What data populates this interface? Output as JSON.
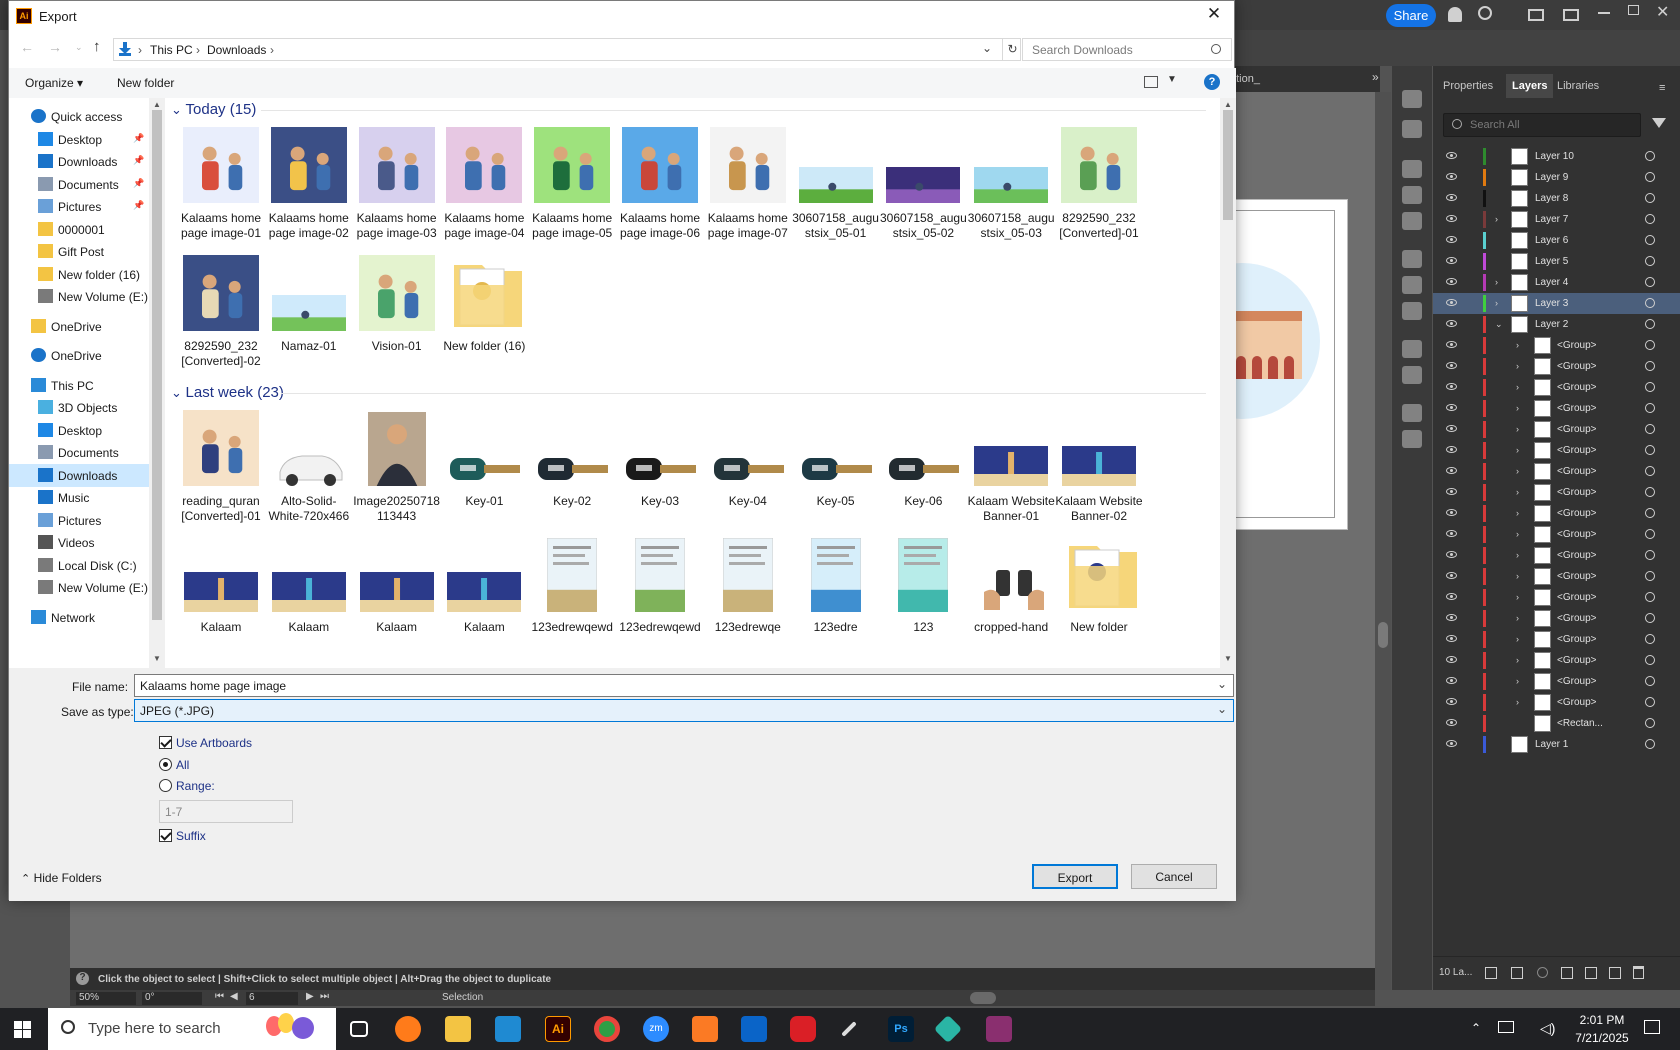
{
  "illustrator": {
    "top": {
      "share_label": "Share"
    },
    "document_tab": "ple_giving_donation_",
    "panel_tabs": [
      "Properties",
      "Layers",
      "Libraries"
    ],
    "search_placeholder": "Search All",
    "layers": [
      {
        "name": "Layer 10",
        "color": "#2e8b2e",
        "expand": false
      },
      {
        "name": "Layer 9",
        "color": "#e07a10",
        "expand": false
      },
      {
        "name": "Layer 8",
        "color": "#111111",
        "expand": false
      },
      {
        "name": "Layer 7",
        "color": "#7a3a3a",
        "expand": true
      },
      {
        "name": "Layer 6",
        "color": "#5ad0d0",
        "expand": false
      },
      {
        "name": "Layer 5",
        "color": "#c04ad8",
        "expand": false
      },
      {
        "name": "Layer 4",
        "color": "#b53ab5",
        "expand": true
      },
      {
        "name": "Layer 3",
        "color": "#3fcf3f",
        "expand": true,
        "selected": true
      },
      {
        "name": "Layer 2",
        "color": "#d83a3a",
        "expand": true,
        "open": true
      },
      {
        "name": "<Group>",
        "color": "#d83a3a",
        "sub": true
      },
      {
        "name": "<Group>",
        "color": "#d83a3a",
        "sub": true
      },
      {
        "name": "<Group>",
        "color": "#d83a3a",
        "sub": true
      },
      {
        "name": "<Group>",
        "color": "#d83a3a",
        "sub": true
      },
      {
        "name": "<Group>",
        "color": "#d83a3a",
        "sub": true
      },
      {
        "name": "<Group>",
        "color": "#d83a3a",
        "sub": true
      },
      {
        "name": "<Group>",
        "color": "#d83a3a",
        "sub": true
      },
      {
        "name": "<Group>",
        "color": "#d83a3a",
        "sub": true
      },
      {
        "name": "<Group>",
        "color": "#d83a3a",
        "sub": true
      },
      {
        "name": "<Group>",
        "color": "#d83a3a",
        "sub": true
      },
      {
        "name": "<Group>",
        "color": "#d83a3a",
        "sub": true
      },
      {
        "name": "<Group>",
        "color": "#d83a3a",
        "sub": true
      },
      {
        "name": "<Group>",
        "color": "#d83a3a",
        "sub": true
      },
      {
        "name": "<Group>",
        "color": "#d83a3a",
        "sub": true
      },
      {
        "name": "<Group>",
        "color": "#d83a3a",
        "sub": true
      },
      {
        "name": "<Group>",
        "color": "#d83a3a",
        "sub": true
      },
      {
        "name": "<Group>",
        "color": "#d83a3a",
        "sub": true
      },
      {
        "name": "<Group>",
        "color": "#d83a3a",
        "sub": true
      },
      {
        "name": "<Rectan...",
        "color": "#d83a3a",
        "sub": true,
        "noexpand": true
      },
      {
        "name": "Layer 1",
        "color": "#3a5ad8",
        "expand": false
      }
    ],
    "layers_count": "10 La...",
    "status_hint": "Click the object to select  |  Shift+Click to select multiple object  |  Alt+Drag the object to duplicate",
    "zoom": "50%",
    "rotation": "0°",
    "artboard_num": "6",
    "tool_name": "Selection"
  },
  "dialog": {
    "title": "Export",
    "breadcrumb": [
      "This PC",
      "Downloads"
    ],
    "search_placeholder": "Search Downloads",
    "organize_label": "Organize",
    "new_folder_label": "New folder",
    "nav": [
      {
        "label": "Quick access",
        "icon": "star-icon",
        "level": 0
      },
      {
        "label": "Desktop",
        "icon": "desktop-icon",
        "level": 1,
        "pin": true
      },
      {
        "label": "Downloads",
        "icon": "download-icon",
        "level": 1,
        "pin": true
      },
      {
        "label": "Documents",
        "icon": "documents-icon",
        "level": 1,
        "pin": true
      },
      {
        "label": "Pictures",
        "icon": "pictures-icon",
        "level": 1,
        "pin": true
      },
      {
        "label": "0000001",
        "icon": "folder-icon",
        "level": 1
      },
      {
        "label": "Gift Post",
        "icon": "folder-icon",
        "level": 1
      },
      {
        "label": "New folder (16)",
        "icon": "folder-icon",
        "level": 1
      },
      {
        "label": "New Volume (E:)",
        "icon": "drive-icon",
        "level": 1
      },
      {
        "label": "OneDrive",
        "icon": "folder-icon",
        "level": 0,
        "gap": true
      },
      {
        "label": "OneDrive",
        "icon": "cloud-icon",
        "level": 0,
        "gap": true
      },
      {
        "label": "This PC",
        "icon": "computer-icon",
        "level": 0,
        "gap": true
      },
      {
        "label": "3D Objects",
        "icon": "cube-icon",
        "level": 1
      },
      {
        "label": "Desktop",
        "icon": "desktop-icon",
        "level": 1
      },
      {
        "label": "Documents",
        "icon": "documents-icon",
        "level": 1
      },
      {
        "label": "Downloads",
        "icon": "download-icon",
        "level": 1,
        "selected": true
      },
      {
        "label": "Music",
        "icon": "music-icon",
        "level": 1
      },
      {
        "label": "Pictures",
        "icon": "pictures-icon",
        "level": 1
      },
      {
        "label": "Videos",
        "icon": "video-icon",
        "level": 1
      },
      {
        "label": "Local Disk (C:)",
        "icon": "drive-icon",
        "level": 1
      },
      {
        "label": "New Volume (E:)",
        "icon": "drive-icon",
        "level": 1
      },
      {
        "label": "Network",
        "icon": "network-icon",
        "level": 0,
        "gap": true
      }
    ],
    "groups": [
      {
        "label": "Today (15)",
        "rows": [
          [
            {
              "caption": "Kalaams home page image-01",
              "kind": "illus",
              "c1": "#e9eefc",
              "c2": "#d94f3d"
            },
            {
              "caption": "Kalaams home page image-02",
              "kind": "illus",
              "c1": "#3b4f86",
              "c2": "#f2c34a"
            },
            {
              "caption": "Kalaams home page image-03",
              "kind": "illus",
              "c1": "#d7d0ee",
              "c2": "#4a5a8a"
            },
            {
              "caption": "Kalaams home page image-04",
              "kind": "illus",
              "c1": "#e7c8e3",
              "c2": "#3e6fb0"
            },
            {
              "caption": "Kalaams home page image-05",
              "kind": "illus",
              "c1": "#9ee27d",
              "c2": "#1e6e3c"
            },
            {
              "caption": "Kalaams home page image-06",
              "kind": "illus",
              "c1": "#5aa9e8",
              "c2": "#c9473a"
            },
            {
              "caption": "Kalaams home page image-07",
              "kind": "illus",
              "c1": "#f3f3f3",
              "c2": "#c8964e"
            },
            {
              "caption": "30607158_augustsix_05-01",
              "kind": "wide",
              "c1": "#cde9f8",
              "c2": "#5cae3e"
            },
            {
              "caption": "30607158_augustsix_05-02",
              "kind": "wide",
              "c1": "#3b2f7a",
              "c2": "#8a5bb8"
            },
            {
              "caption": "30607158_augustsix_05-03",
              "kind": "wide",
              "c1": "#9fd8ef",
              "c2": "#6bbf5a"
            },
            {
              "caption": "8292590_232 [Converted]-01",
              "kind": "illus",
              "c1": "#d9f0c9",
              "c2": "#5a9f54"
            }
          ],
          [
            {
              "caption": "8292590_232 [Converted]-02",
              "kind": "illus",
              "c1": "#3a4f86",
              "c2": "#e7d9b5"
            },
            {
              "caption": "Namaz-01",
              "kind": "wide",
              "c1": "#cfeafb",
              "c2": "#74c25a"
            },
            {
              "caption": "Vision-01",
              "kind": "illus",
              "c1": "#e4f3cf",
              "c2": "#4aa36b"
            },
            {
              "caption": "New folder (16)",
              "kind": "folder",
              "c1": "#f6d67a",
              "c2": "#e3b84e"
            }
          ]
        ]
      },
      {
        "label": "Last week (23)",
        "rows": [
          [
            {
              "caption": "reading_quran [Converted]-01",
              "kind": "illus",
              "c1": "#f6e2c8",
              "c2": "#2f3f7e"
            },
            {
              "caption": "Alto-Solid-White-720x466",
              "kind": "car",
              "c1": "#f2f2f2",
              "c2": "#bdbdbd"
            },
            {
              "caption": "Image20250718113443",
              "kind": "photo",
              "c1": "#b9a68f",
              "c2": "#2b2f3a"
            },
            {
              "caption": "Key-01",
              "kind": "key",
              "c1": "#1e5c5a",
              "c2": "#b08a4a"
            },
            {
              "caption": "Key-02",
              "kind": "key",
              "c1": "#1f2a33",
              "c2": "#b08a4a"
            },
            {
              "caption": "Key-03",
              "kind": "key",
              "c1": "#1a1a1a",
              "c2": "#b08a4a"
            },
            {
              "caption": "Key-04",
              "kind": "key",
              "c1": "#23343a",
              "c2": "#b08a4a"
            },
            {
              "caption": "Key-05",
              "kind": "key",
              "c1": "#1d3a45",
              "c2": "#b08a4a"
            },
            {
              "caption": "Key-06",
              "kind": "key",
              "c1": "#222b30",
              "c2": "#b08a4a"
            },
            {
              "caption": "Kalaam Website Banner-01",
              "kind": "banner",
              "c1": "#2b3a8a",
              "c2": "#e3b26a"
            },
            {
              "caption": "Kalaam Website Banner-02",
              "kind": "banner",
              "c1": "#2b3a8a",
              "c2": "#4ab3d8"
            }
          ],
          [
            {
              "caption": "Kalaam",
              "kind": "banner",
              "c1": "#2b3a8a",
              "c2": "#e3b26a"
            },
            {
              "caption": "Kalaam",
              "kind": "banner",
              "c1": "#2b3a8a",
              "c2": "#4ab3d8"
            },
            {
              "caption": "Kalaam",
              "kind": "banner",
              "c1": "#2b3a8a",
              "c2": "#e3b26a"
            },
            {
              "caption": "Kalaam",
              "kind": "banner",
              "c1": "#2b3a8a",
              "c2": "#4ab3d8"
            },
            {
              "caption": "123edrewqewd",
              "kind": "doc",
              "c1": "#eaf3f8",
              "c2": "#c9b27a"
            },
            {
              "caption": "123edrewqewd",
              "kind": "doc",
              "c1": "#eaf3f8",
              "c2": "#7fb25a"
            },
            {
              "caption": "123edrewqe",
              "kind": "doc",
              "c1": "#eaf3f8",
              "c2": "#c9b27a"
            },
            {
              "caption": "123edre",
              "kind": "doc",
              "c1": "#d6eefa",
              "c2": "#3f8fd0"
            },
            {
              "caption": "123",
              "kind": "doc",
              "c1": "#b7ece9",
              "c2": "#41b8ad"
            },
            {
              "caption": "cropped-hand",
              "kind": "hand",
              "c1": "#ffffff",
              "c2": "#333333"
            },
            {
              "caption": "New folder",
              "kind": "folder",
              "c1": "#f6d67a",
              "c2": "#2b3a8a"
            }
          ]
        ]
      }
    ],
    "file_name_label": "File name:",
    "file_name_value": "Kalaams home page image",
    "save_type_label": "Save as type:",
    "save_type_value": "JPEG (*.JPG)",
    "use_artboards_label": "Use Artboards",
    "all_label": "All",
    "range_label": "Range:",
    "range_value": "1-7",
    "suffix_label": "Suffix",
    "hide_folders_label": "Hide Folders",
    "export_label": "Export",
    "cancel_label": "Cancel"
  },
  "taskbar": {
    "search_placeholder": "Type here to search",
    "time": "2:01 PM",
    "date": "7/21/2025"
  }
}
